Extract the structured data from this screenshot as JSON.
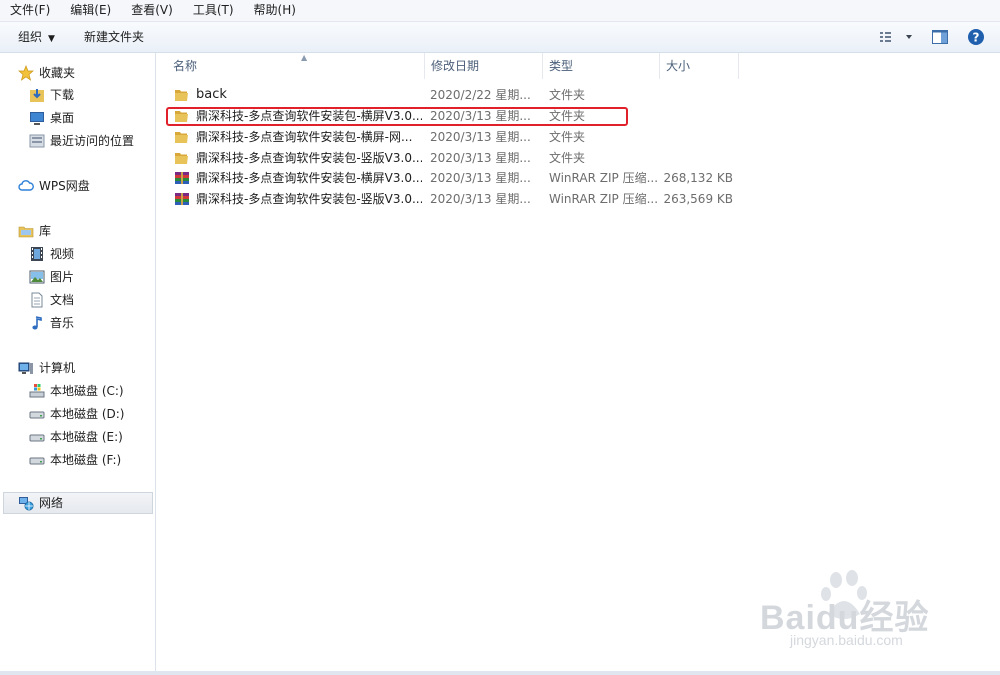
{
  "menubar": {
    "items": [
      "文件(F)",
      "编辑(E)",
      "查看(V)",
      "工具(T)",
      "帮助(H)"
    ]
  },
  "toolbar": {
    "organize_label": "组织",
    "new_folder_label": "新建文件夹"
  },
  "sidebar": {
    "favorites": {
      "label": "收藏夹",
      "items": [
        "下载",
        "桌面",
        "最近访问的位置"
      ]
    },
    "wps": {
      "label": "WPS网盘"
    },
    "libraries": {
      "label": "库",
      "items": [
        "视频",
        "图片",
        "文档",
        "音乐"
      ]
    },
    "computer": {
      "label": "计算机",
      "items": [
        "本地磁盘 (C:)",
        "本地磁盘 (D:)",
        "本地磁盘 (E:)",
        "本地磁盘 (F:)"
      ]
    },
    "network": {
      "label": "网络"
    }
  },
  "columns": {
    "name": "名称",
    "date": "修改日期",
    "type": "类型",
    "size": "大小"
  },
  "files": [
    {
      "name": "back",
      "date": "2020/2/22 星期...",
      "type": "文件夹",
      "size": "",
      "icon": "folder-icon"
    },
    {
      "name": "鼎深科技-多点查询软件安装包-横屏V3.0...",
      "date": "2020/3/13 星期...",
      "type": "文件夹",
      "size": "",
      "icon": "folder-icon"
    },
    {
      "name": "鼎深科技-多点查询软件安装包-横屏-网...",
      "date": "2020/3/13 星期...",
      "type": "文件夹",
      "size": "",
      "icon": "folder-icon"
    },
    {
      "name": "鼎深科技-多点查询软件安装包-竖版V3.0...",
      "date": "2020/3/13 星期...",
      "type": "文件夹",
      "size": "",
      "icon": "folder-icon"
    },
    {
      "name": "鼎深科技-多点查询软件安装包-横屏V3.0...",
      "date": "2020/3/13 星期...",
      "type": "WinRAR ZIP 压缩...",
      "size": "268,132 KB",
      "icon": "zip-archive-icon"
    },
    {
      "name": "鼎深科技-多点查询软件安装包-竖版V3.0...",
      "date": "2020/3/13 星期...",
      "type": "WinRAR ZIP 压缩...",
      "size": "263,569 KB",
      "icon": "zip-archive-icon"
    }
  ],
  "watermark": {
    "brand": "Baidu经验",
    "url": "jingyan.baidu.com"
  },
  "colors": {
    "highlight": "#e0202a",
    "folder": "#e8c35a",
    "header_text": "#4c607a"
  }
}
